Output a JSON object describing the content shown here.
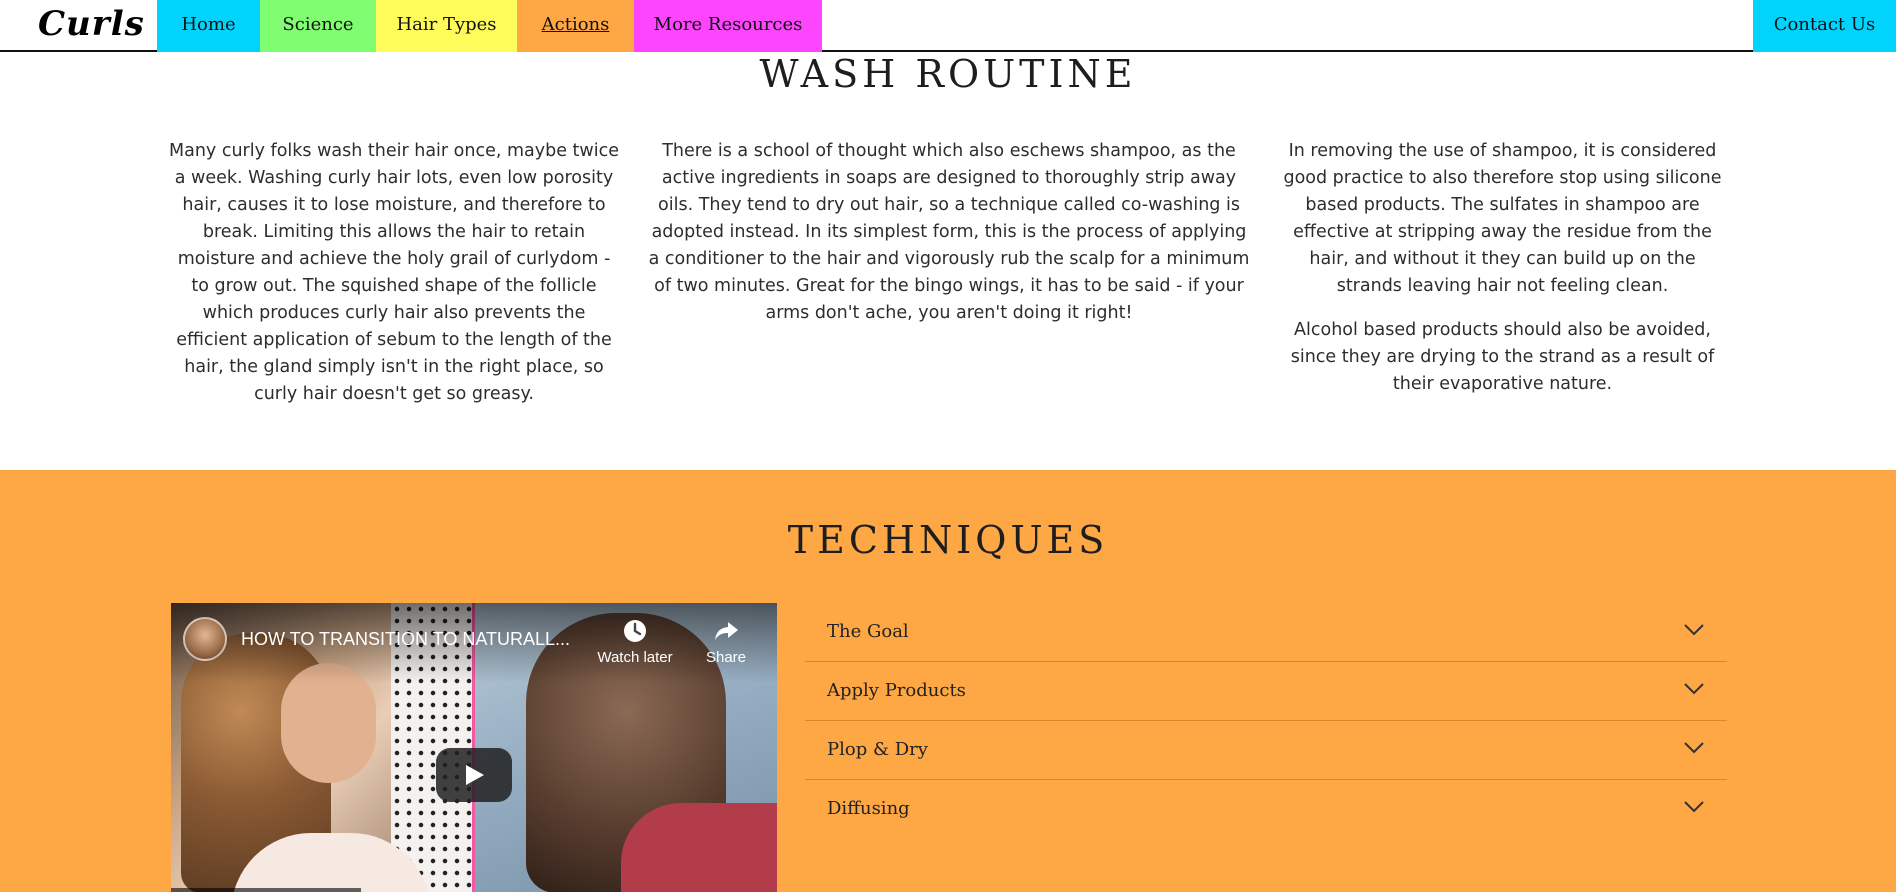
{
  "nav": {
    "brand": "Curls",
    "items": [
      {
        "label": "Home",
        "color": "#00d4fc"
      },
      {
        "label": "Science",
        "color": "#80fd70"
      },
      {
        "label": "Hair Types",
        "color": "#fdfc5a"
      },
      {
        "label": "Actions",
        "color": "#fea745",
        "active": true
      },
      {
        "label": "More Resources",
        "color": "#fd45fd"
      }
    ],
    "contact": {
      "label": "Contact Us",
      "color": "#00d4fc"
    }
  },
  "wash_routine": {
    "title": "WASH ROUTINE",
    "col1": [
      "Many curly folks wash their hair once, maybe twice a week. Washing curly hair lots, even low porosity hair, causes it to lose moisture, and therefore to break. Limiting this allows the hair to retain moisture and achieve the holy grail of curlydom - to grow out. The squished shape of the follicle which produces curly hair also prevents the efficient application of sebum to the length of the hair, the gland simply isn't in the right place, so curly hair doesn't get so greasy."
    ],
    "col2": [
      "There is a school of thought which also eschews shampoo, as the active ingredients in soaps are designed to thoroughly strip away oils. They tend to dry out hair, so a technique called co-washing is adopted instead. In its simplest form, this is the process of applying a conditioner to the hair and vigorously rub the scalp for a minimum of two minutes. Great for the bingo wings, it has to be said - if your arms don't ache, you aren't doing it right!"
    ],
    "col3": [
      "In removing the use of shampoo, it is considered good practice to also therefore stop using silicone based products. The sulfates in shampoo are effective at stripping away the residue from the hair, and without it they can build up on the strands leaving hair not feeling clean.",
      "Alcohol based products should also be avoided, since they are drying to the strand as a result of their evaporative nature."
    ]
  },
  "techniques": {
    "title": "TECHNIQUES",
    "background": "#fea745",
    "video": {
      "title": "HOW TO TRANSITION TO NATURALL...",
      "watch_later": "Watch later",
      "share": "Share",
      "icons": [
        "channel-avatar-icon",
        "clock-icon",
        "share-icon",
        "play-icon"
      ]
    },
    "accordion": [
      {
        "label": "The Goal"
      },
      {
        "label": "Apply Products"
      },
      {
        "label": "Plop & Dry"
      },
      {
        "label": "Diffusing"
      }
    ]
  }
}
